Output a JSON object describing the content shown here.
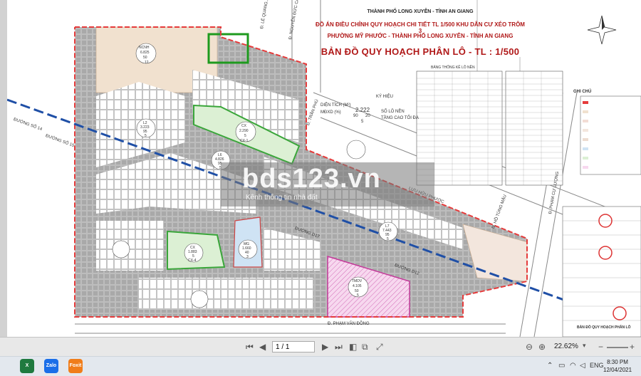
{
  "map": {
    "city_line": "THÀNH PHỐ LONG XUYÊN - TỈNH AN GIANG",
    "title_line1": "ĐỒ ÁN ĐIỀU CHỈNH QUY HOẠCH CHI TIẾT TL 1/500 KHU DÂN CƯ XÉO TRÔM 3",
    "title_line2": "PHƯỜNG MỸ PHƯỚC - THÀNH PHỐ LONG XUYÊN - TỈNH AN GIANG",
    "title_main": "BẢN ĐỒ QUY HOẠCH PHÂN LÔ - TL : 1/500",
    "legend_heading": "GHI CHÚ",
    "legend_key": "KÝ HIỆU",
    "legend_area": "DIỆN TÍCH (M²)",
    "legend_mdxd": "MĐXD (%)",
    "legend_lots": "SỐ LÔ NỀN",
    "legend_floors": "TẦNG CAO TỐI ĐA",
    "legend_sample": [
      "2.222",
      "90",
      "20",
      "5"
    ],
    "table_heading": "BẢNG THỐNG KÊ LÔ NỀN",
    "footer_label": "BẢN ĐỒ QUY HOẠCH PHÂN LÔ",
    "roads": {
      "le_quang": "Đ. LÊ QUANG...",
      "nguyen_duc": "Đ. NGUYỄN ĐỨC CẢ...",
      "tran_phu": "Đ. TRẦN PHÚ",
      "luu_huu_phuoc": "LƯU HỮU PHƯỚC",
      "ho_tung_mau": "Đ. HỒ TÙNG MẬU",
      "pham_cu_luong": "Đ. PHẠM CỰ LƯỢNG",
      "pham_van_dong": "Đ. PHẠM VĂN ĐỒNG",
      "duong_so_14": "ĐƯỜNG SỐ 14",
      "duong_so_15": "ĐƯỜNG SỐ 15",
      "duong_d17": "ĐƯỜNG D17",
      "duong_d12": "ĐƯỜNG D12"
    },
    "blocks": {
      "ncnh": [
        "NCNH",
        "6.825",
        "50",
        "12"
      ],
      "cx_green": [
        "CX",
        "2.290",
        "5",
        "CX-1"
      ],
      "cx2": [
        "CX",
        "1.883",
        "5",
        "CX-4"
      ],
      "mg": [
        "MG",
        "1.660",
        "40",
        "3"
      ],
      "tmdv": [
        "TMDV",
        "4.105",
        "50",
        "5"
      ],
      "l6": [
        "L6",
        "4.826",
        "95",
        "5"
      ],
      "l7": [
        "L7",
        "7.443",
        "95",
        "5"
      ],
      "lk": [
        "L2",
        "3.223",
        "95",
        "5"
      ]
    }
  },
  "watermark": {
    "brand": "bds123.vn",
    "tagline": "Kênh thông tin nhà đất"
  },
  "toolbar": {
    "page_value": "1 / 1",
    "zoom": "22.62%"
  },
  "taskbar": {
    "apps": [
      "X",
      "Zalo",
      "Foxit"
    ],
    "lang": "ENG",
    "time": "8:30 PM",
    "date": "12/04/2021"
  },
  "colors": {
    "boundary": "#e53b3b",
    "road_blue": "#1f4fa6",
    "green_area": "#3aa63a",
    "pink_area": "#c43a9a",
    "title_red": "#b01818"
  }
}
